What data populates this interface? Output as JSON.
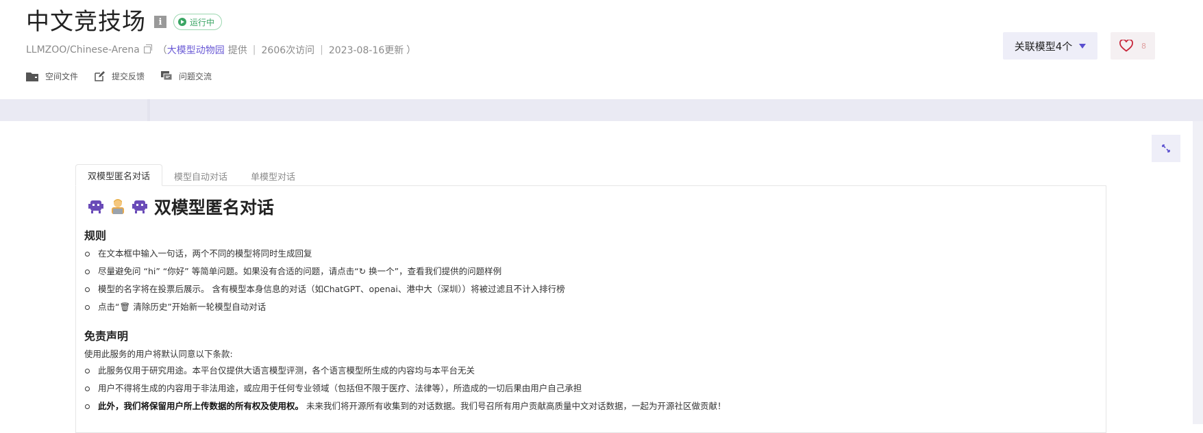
{
  "header": {
    "title": "中文竞技场",
    "info_icon": "info-icon",
    "status": "运行中",
    "repo": "LLMZOO/Chinese-Arena",
    "provider_prefix": "（",
    "provider_link": "大模型动物园",
    "provider_suffix": "提供",
    "visits": "2606次访问",
    "updated": "2023-08-16更新",
    "closing_paren": "）",
    "actions": [
      {
        "label": "空间文件",
        "icon": "folder-icon"
      },
      {
        "label": "提交反馈",
        "icon": "edit-icon"
      },
      {
        "label": "问题交流",
        "icon": "chat-icon"
      }
    ],
    "related_models": "关联模型4个",
    "likes": "8"
  },
  "tabs": [
    {
      "label": "双模型匿名对话",
      "active": true
    },
    {
      "label": "模型自动对话",
      "active": false
    },
    {
      "label": "单模型对话",
      "active": false
    }
  ],
  "content": {
    "heading": "双模型匿名对话",
    "rules_title": "规则",
    "rules": [
      "在文本框中输入一句话，两个不同的模型将同时生成回复",
      "尽量避免问 “hi” “你好” 等简单问题。如果没有合适的问题，请点击“↻ 换一个”，查看我们提供的问题样例",
      "模型的名字将在投票后展示。 含有模型本身信息的对话（如ChatGPT、openai、港中大（深圳））将被过滤且不计入排行榜",
      "点击“🗑 清除历史”开始新一轮模型自动对话"
    ],
    "disclaimer_title": "免责声明",
    "disclaimer_intro": "使用此服务的用户将默认同意以下条款:",
    "disclaimers": [
      "此服务仅用于研究用途。本平台仅提供大语言模型评测，各个语言模型所生成的内容均与本平台无关",
      "用户不得将生成的内容用于非法用途，或应用于任何专业领域（包括但不限于医疗、法律等），所造成的一切后果由用户自己承担"
    ],
    "disclaimer_last_bold": "此外，我们将保留用户所上传数据的所有权及使用权。",
    "disclaimer_last_rest": "未来我们将开源所有收集到的对话数据。我们号召所有用户贡献高质量中文对话数据，一起为开源社区做贡献！"
  },
  "colors": {
    "accent": "#5a4fcf",
    "status_green": "#3aa563",
    "link": "#6b5bd6"
  }
}
